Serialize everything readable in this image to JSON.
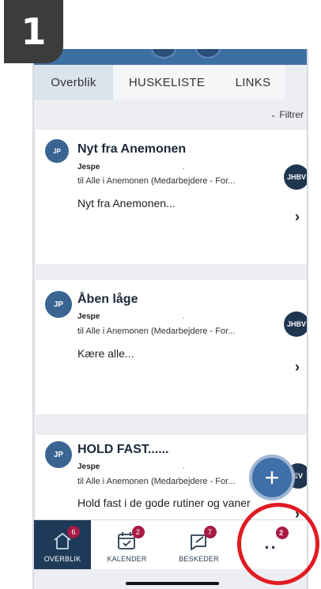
{
  "step": {
    "number": "1"
  },
  "tabs": [
    {
      "label": "Overblik"
    },
    {
      "label": "HUSKELISTE"
    },
    {
      "label": "LINKS"
    }
  ],
  "filter": {
    "label": "Filtrer"
  },
  "posts": [
    {
      "initials": "JP",
      "title": "Nyt fra Anemonen",
      "sender": "Jespe",
      "dot": ".",
      "to": "til Alle i Anemonen (Medarbejdere - For...",
      "body": "Nyt fra Anemonen...",
      "side_badge": "JHBV"
    },
    {
      "initials": "JP",
      "title": "Åben låge",
      "sender": "Jespe",
      "dot": ".",
      "to": "til Alle i Anemonen (Medarbejdere - For...",
      "body": "Kære alle...",
      "side_badge": "JHBV"
    },
    {
      "initials": "JP",
      "title": "HOLD FAST......",
      "sender": "Jespe",
      "dot": ".",
      "to": "til Alle i Anemonen (Medarbejdere - For...",
      "body": "Hold fast i de gode rutiner og vaner",
      "side_badge": "EV"
    }
  ],
  "fab": {
    "icon": "plus-icon",
    "glyph": "+"
  },
  "bottom_nav": [
    {
      "label": "OVERBLIK",
      "icon": "home-icon",
      "count": "6"
    },
    {
      "label": "KALENDER",
      "icon": "calendar-icon",
      "count": "2"
    },
    {
      "label": "BESKEDER",
      "icon": "message-icon",
      "count": "7"
    },
    {
      "label": "",
      "icon": "more-icon",
      "count": "2",
      "glyph": ".."
    }
  ],
  "colors": {
    "brand_blue": "#3e6fa3",
    "nav_active": "#1d3a58",
    "badge_red": "#a81a46",
    "highlight_red": "#e11b22"
  }
}
